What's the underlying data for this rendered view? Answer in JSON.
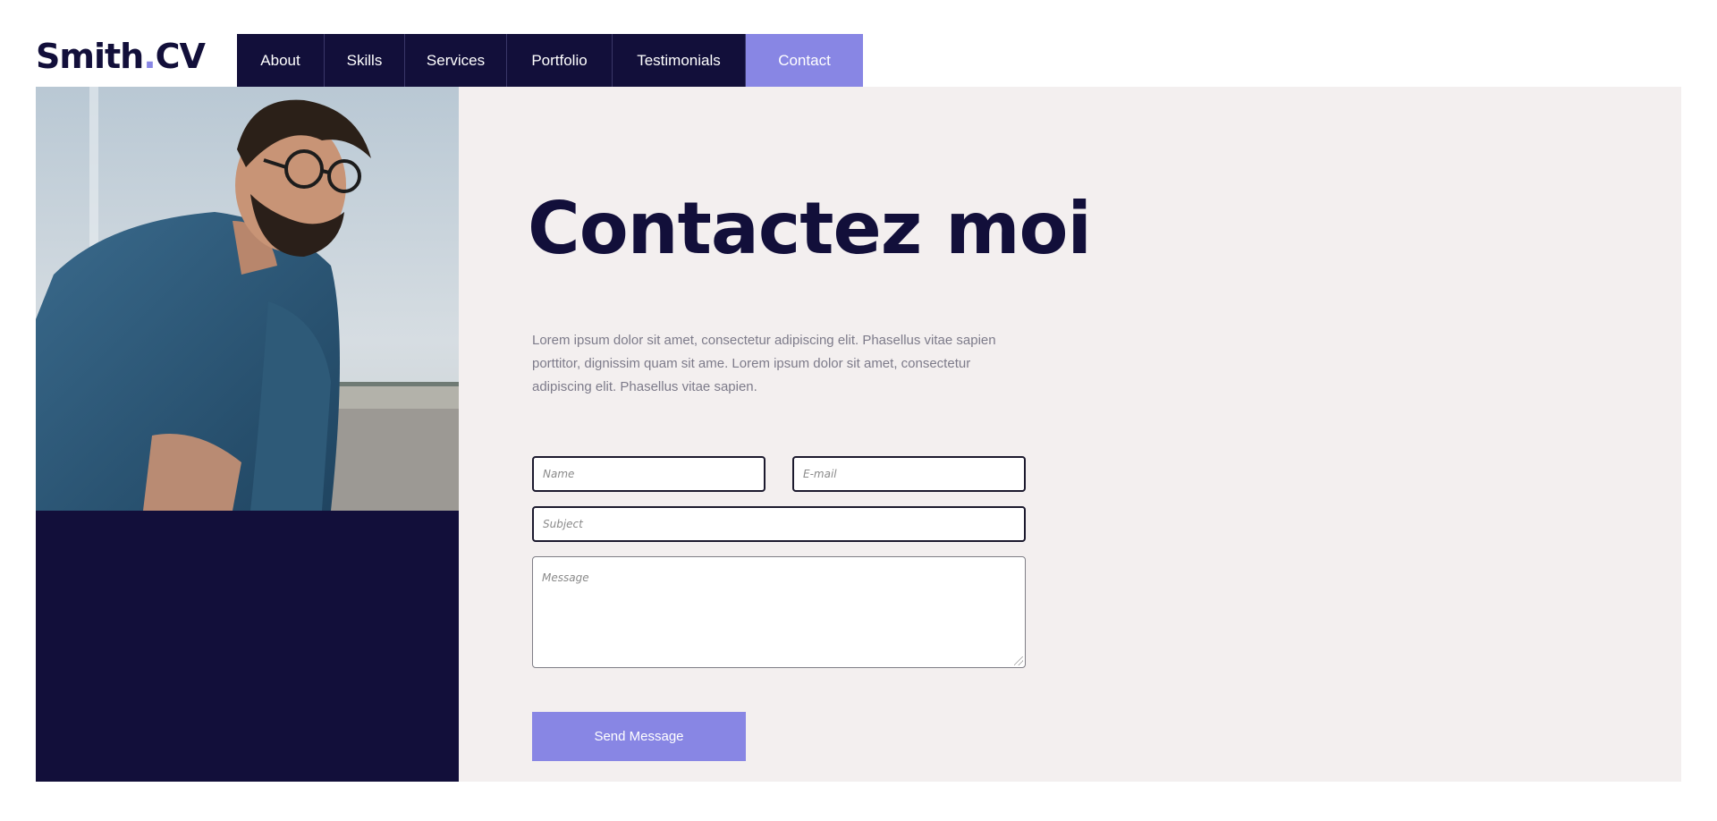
{
  "brand": {
    "name": "Smith",
    "dot": ".",
    "suffix": "CV"
  },
  "nav": {
    "items": [
      {
        "label": "About"
      },
      {
        "label": "Skills"
      },
      {
        "label": "Services"
      },
      {
        "label": "Portfolio"
      },
      {
        "label": "Testimonials"
      },
      {
        "label": "Contact",
        "active": true
      }
    ]
  },
  "contact": {
    "title": "Contactez moi",
    "description": "Lorem ipsum dolor sit amet, consectetur adipiscing elit. Phasellus vitae sapien porttitor, dignissim quam sit ame. Lorem ipsum dolor sit amet, consectetur adipiscing elit. Phasellus vitae sapien."
  },
  "form": {
    "name_placeholder": "Name",
    "email_placeholder": "E-mail",
    "subject_placeholder": "Subject",
    "message_placeholder": "Message",
    "submit_label": "Send Message"
  },
  "colors": {
    "navy": "#120f3a",
    "accent": "#8886e4",
    "content_bg": "#f3efef",
    "body_text": "#7d7b8a"
  },
  "image": {
    "subject": "portrait-photo"
  }
}
